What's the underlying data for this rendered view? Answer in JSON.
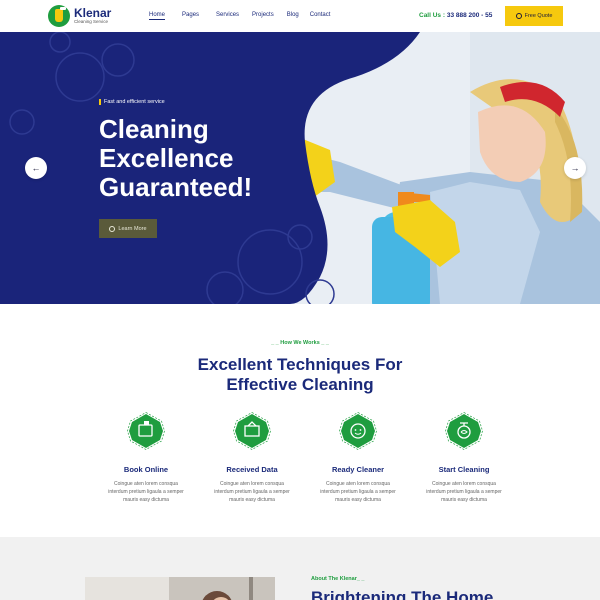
{
  "header": {
    "logo_name": "Klenar",
    "logo_sub": "Cleaning Service",
    "nav": [
      {
        "label": "Home",
        "active": true
      },
      {
        "label": "Pages"
      },
      {
        "label": "Services"
      },
      {
        "label": "Projects"
      },
      {
        "label": "Blog"
      },
      {
        "label": "Contact"
      }
    ],
    "call_label": "Call Us :",
    "call_number": "33 888 200 - 55",
    "quote_label": "Free Quote"
  },
  "hero": {
    "tagline": "Fast and efficient service",
    "title_line1": "Cleaning",
    "title_line2": "Excellence",
    "title_line3": "Guaranteed!",
    "button_label": "Learn More",
    "prev_arrow": "←",
    "next_arrow": "→"
  },
  "how": {
    "eyebrow": "_ _ How We Works _ _",
    "title_line1": "Excellent Techniques For",
    "title_line2": "Effective Cleaning",
    "steps": [
      {
        "title": "Book Online",
        "desc_line1": "Coingue aten lorem consqua",
        "desc_line2": "interdum pretium ligaula a semper",
        "desc_line3": "mauris easy dictuma",
        "icon": "calendar-spray-icon"
      },
      {
        "title": "Received Data",
        "desc_line1": "Coingue aten lorem consqua",
        "desc_line2": "interdum pretium ligaula a semper",
        "desc_line3": "mauris easy dictuma",
        "icon": "data-box-icon"
      },
      {
        "title": "Ready Cleaner",
        "desc_line1": "Coingue aten lorem consqua",
        "desc_line2": "interdum pretium ligaula a semper",
        "desc_line3": "mauris easy dictuma",
        "icon": "cleaner-face-icon"
      },
      {
        "title": "Start Cleaning",
        "desc_line1": "Coingue aten lorem consqua",
        "desc_line2": "interdum pretium ligaula a semper",
        "desc_line3": "mauris easy dictuma",
        "icon": "spray-bottle-icon"
      }
    ]
  },
  "about": {
    "eyebrow": "About The Klenar_ _",
    "title": "Brightening The Home"
  },
  "colors": {
    "brand_blue": "#1b2a7a",
    "hero_blue": "#1a247a",
    "brand_green": "#1f9d3f",
    "accent_yellow": "#f6c90e"
  }
}
